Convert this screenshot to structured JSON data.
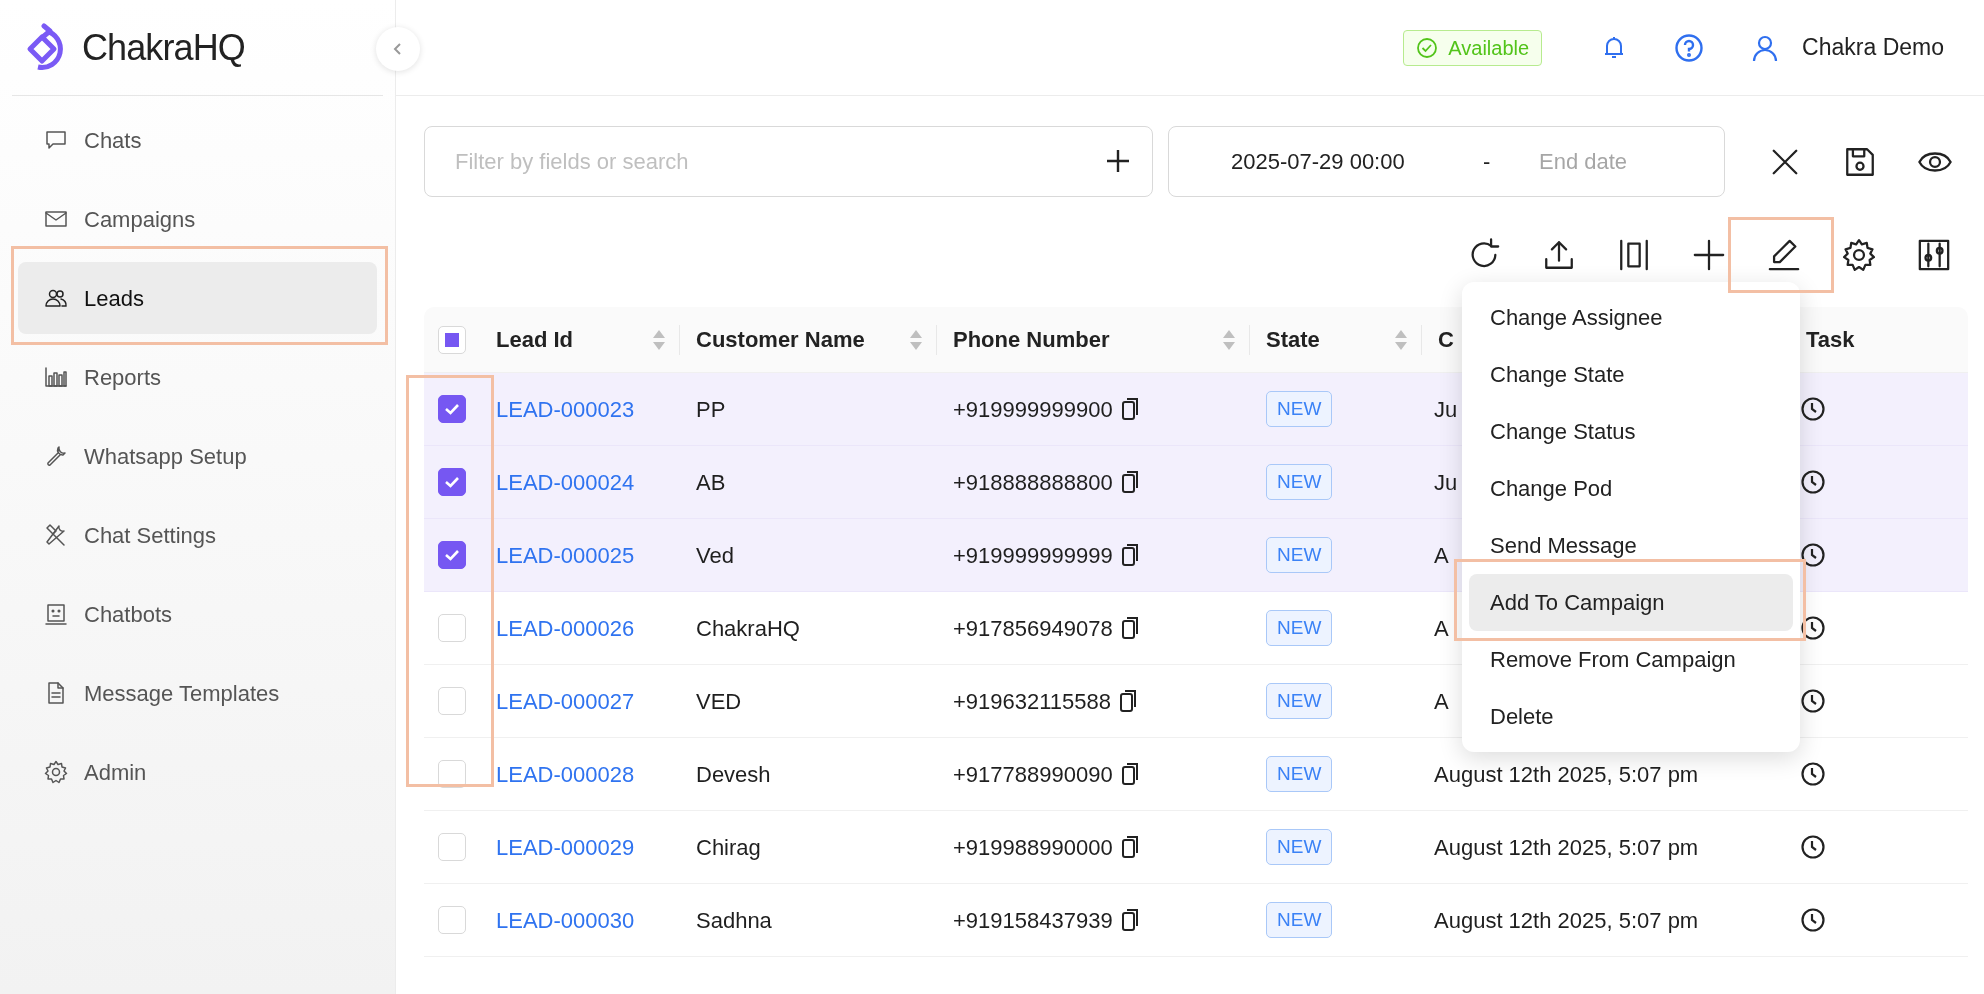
{
  "brand": {
    "name": "ChakraHQ"
  },
  "sidebar": {
    "items": [
      {
        "label": "Chats",
        "selected": false,
        "highlighted": false
      },
      {
        "label": "Campaigns",
        "selected": false,
        "highlighted": false
      },
      {
        "label": "Leads",
        "selected": true,
        "highlighted": true
      },
      {
        "label": "Reports",
        "selected": false,
        "highlighted": false
      },
      {
        "label": "Whatsapp Setup",
        "selected": false,
        "highlighted": false
      },
      {
        "label": "Chat Settings",
        "selected": false,
        "highlighted": false
      },
      {
        "label": "Chatbots",
        "selected": false,
        "highlighted": false
      },
      {
        "label": "Message Templates",
        "selected": false,
        "highlighted": false
      },
      {
        "label": "Admin",
        "selected": false,
        "highlighted": false
      }
    ]
  },
  "header": {
    "status": "Available",
    "user": "Chakra Demo"
  },
  "filters": {
    "search_placeholder": "Filter by fields or search",
    "start_date": "2025-07-29 00:00",
    "separator": "-",
    "end_placeholder": "End date"
  },
  "toolbar": {
    "tools": [
      {
        "highlighted": false
      },
      {
        "highlighted": false
      },
      {
        "highlighted": false
      },
      {
        "highlighted": false
      },
      {
        "highlighted": true
      },
      {
        "highlighted": false
      },
      {
        "highlighted": false
      }
    ]
  },
  "table": {
    "select_all_indeterminate": true,
    "checkbox_column_highlighted": true,
    "columns": [
      {
        "label": "Lead Id",
        "sortable": true
      },
      {
        "label": "Customer Name",
        "sortable": true
      },
      {
        "label": "Phone Number",
        "sortable": true
      },
      {
        "label": "State",
        "sortable": true
      },
      {
        "label": "C",
        "sortable": false
      },
      {
        "label": "Task",
        "sortable": false
      }
    ],
    "rows": [
      {
        "selected": true,
        "lead_id": "LEAD-000023",
        "name": "PP",
        "phone": "+919999999900",
        "state": "NEW",
        "created": "Ju"
      },
      {
        "selected": true,
        "lead_id": "LEAD-000024",
        "name": "AB",
        "phone": "+918888888800",
        "state": "NEW",
        "created": "Ju"
      },
      {
        "selected": true,
        "lead_id": "LEAD-000025",
        "name": "Ved",
        "phone": "+919999999999",
        "state": "NEW",
        "created": "A"
      },
      {
        "selected": false,
        "lead_id": "LEAD-000026",
        "name": "ChakraHQ",
        "phone": "+917856949078",
        "state": "NEW",
        "created": "A"
      },
      {
        "selected": false,
        "lead_id": "LEAD-000027",
        "name": "VED",
        "phone": "+919632115588",
        "state": "NEW",
        "created": "A"
      },
      {
        "selected": false,
        "lead_id": "LEAD-000028",
        "name": "Devesh",
        "phone": "+917788990090",
        "state": "NEW",
        "created": "August 12th 2025, 5:07 pm"
      },
      {
        "selected": false,
        "lead_id": "LEAD-000029",
        "name": "Chirag",
        "phone": "+919988990000",
        "state": "NEW",
        "created": "August 12th 2025, 5:07 pm"
      },
      {
        "selected": false,
        "lead_id": "LEAD-000030",
        "name": "Sadhna",
        "phone": "+919158437939",
        "state": "NEW",
        "created": "August 12th 2025, 5:07 pm"
      }
    ]
  },
  "menu": {
    "items": [
      {
        "label": "Change Assignee",
        "hovered": false,
        "highlighted": false
      },
      {
        "label": "Change State",
        "hovered": false,
        "highlighted": false
      },
      {
        "label": "Change Status",
        "hovered": false,
        "highlighted": false
      },
      {
        "label": "Change Pod",
        "hovered": false,
        "highlighted": false
      },
      {
        "label": "Send Message",
        "hovered": false,
        "highlighted": false
      },
      {
        "label": "Add To Campaign",
        "hovered": true,
        "highlighted": true
      },
      {
        "label": "Remove From Campaign",
        "hovered": false,
        "highlighted": false
      },
      {
        "label": "Delete",
        "hovered": false,
        "highlighted": false
      }
    ]
  }
}
